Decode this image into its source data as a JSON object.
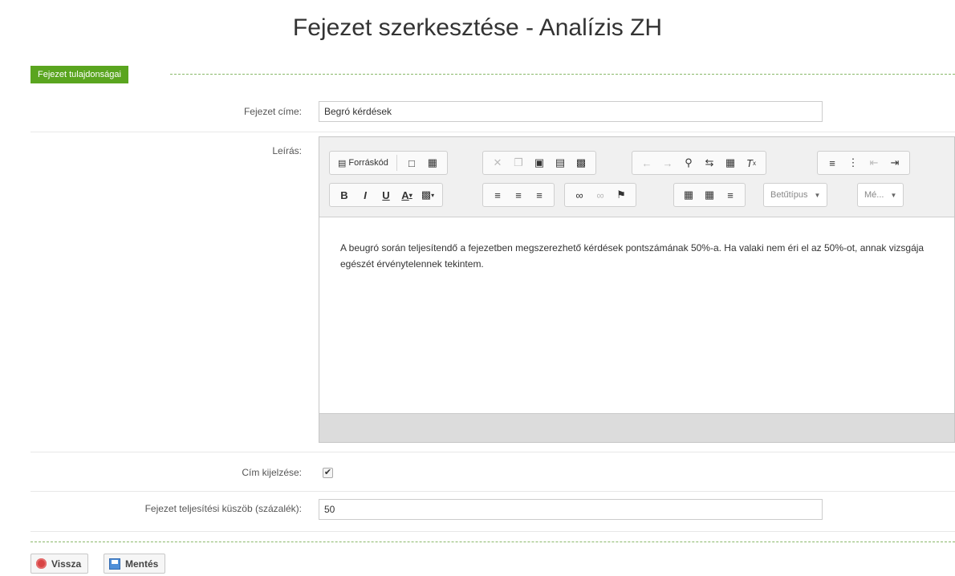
{
  "page": {
    "title": "Fejezet szerkesztése - Analízis ZH"
  },
  "section": {
    "tab_label": "Fejezet tulajdonságai"
  },
  "form": {
    "title_label": "Fejezet címe:",
    "title_value": "Begró kérdések",
    "description_label": "Leírás:",
    "show_title_label": "Cím kijelzése:",
    "show_title_checked": true,
    "threshold_label": "Fejezet teljesítési küszöb (százalék):",
    "threshold_value": "50"
  },
  "editor": {
    "source_button": "Forráskód",
    "font_combo": "Betűtípus",
    "size_combo": "Mé...",
    "content": "A beugró során teljesítendő a fejezetben megszerezhető kérdések pontszámának 50%-a. Ha valaki nem éri el az 50%-ot, annak vizsgája egészét érvénytelennek tekintem."
  },
  "buttons": {
    "back": "Vissza",
    "save": "Mentés"
  },
  "colors": {
    "accent": "#5aa51f",
    "back_icon": "#d84444",
    "save_icon": "#4f8fd8"
  }
}
